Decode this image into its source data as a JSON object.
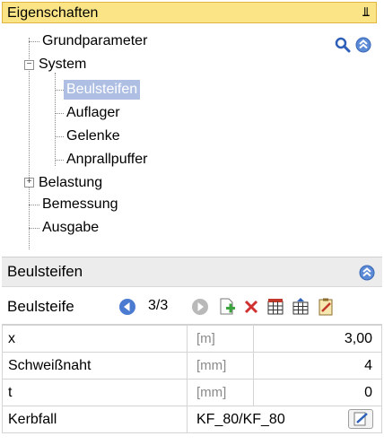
{
  "panel": {
    "title": "Eigenschaften",
    "pin_glyph": "⫫"
  },
  "tree": {
    "items": [
      {
        "label": "Grundparameter"
      },
      {
        "label": "System",
        "toggle": "−"
      },
      {
        "label": "Beulsteifen",
        "selected": true
      },
      {
        "label": "Auflager"
      },
      {
        "label": "Gelenke"
      },
      {
        "label": "Anprallpuffer"
      },
      {
        "label": "Belastung",
        "toggle": "+"
      },
      {
        "label": "Bemessung"
      },
      {
        "label": "Ausgabe"
      }
    ]
  },
  "section": {
    "title": "Beulsteifen"
  },
  "navigator": {
    "label": "Beulsteife",
    "counter": "3/3"
  },
  "properties": {
    "rows": [
      {
        "name": "x",
        "unit": "[m]",
        "value": "3,00"
      },
      {
        "name": "Schweißnaht",
        "unit": "[mm]",
        "value": "4"
      },
      {
        "name": "t",
        "unit": "[mm]",
        "value": "0"
      },
      {
        "name": "Kerbfall",
        "unit": "",
        "value": "KF_80/KF_80"
      }
    ]
  },
  "colors": {
    "title_bg": "#fbe486",
    "selection_bg": "#aebfe3",
    "accent_blue": "#4b7bd0",
    "section_bg": "#ececec"
  },
  "icons": {
    "tree_search": "magnifier-icon",
    "tree_collapse": "collapse-up-icon",
    "section_collapse": "collapse-up-icon",
    "nav_prev": "previous-arrow-icon",
    "nav_next": "next-arrow-icon",
    "nav_new": "new-item-icon",
    "nav_delete": "delete-icon",
    "nav_table_a": "table-grid-icon",
    "nav_table_b": "table-insert-icon",
    "nav_edit": "edit-clipboard-icon",
    "kerbfall_edit": "edit-pencil-icon"
  }
}
